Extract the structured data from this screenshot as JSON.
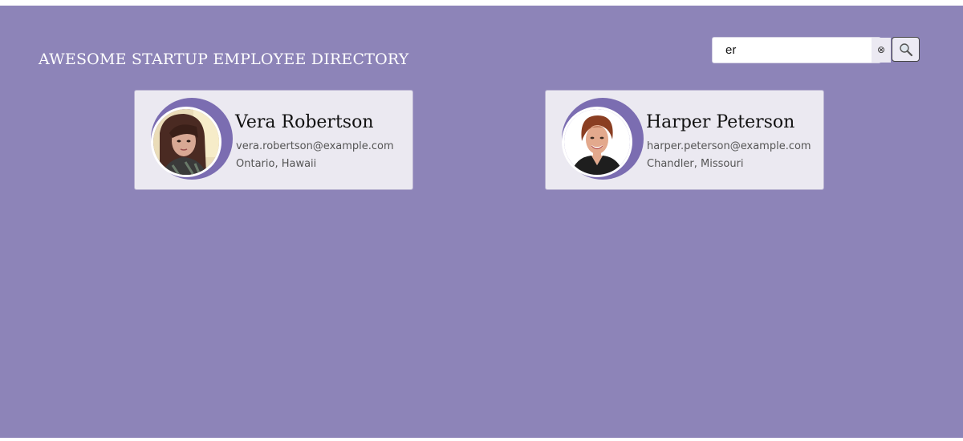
{
  "header": {
    "title": "AWESOME STARTUP EMPLOYEE DIRECTORY"
  },
  "search": {
    "value": "er",
    "clear_icon": "⊗",
    "search_icon": "magnifier-icon"
  },
  "employees": [
    {
      "name": "Vera Robertson",
      "email": "vera.robertson@example.com",
      "location": "Ontario, Hawaii"
    },
    {
      "name": "Harper Peterson",
      "email": "harper.peterson@example.com",
      "location": "Chandler, Missouri"
    }
  ],
  "colors": {
    "background": "#8d84b8",
    "card": "#ebe9f1",
    "accent_arc": "#7b6db1"
  }
}
